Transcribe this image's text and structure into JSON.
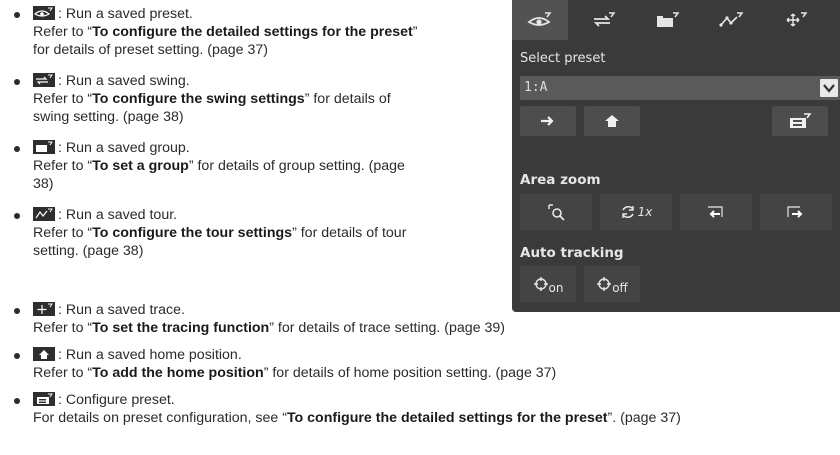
{
  "items": [
    {
      "icon": "preset-eye-icon",
      "lines": [
        [
          {
            "t": ": Run a saved preset.",
            "b": false
          }
        ],
        [
          {
            "t": "Refer to “",
            "b": false
          },
          {
            "t": "To configure the detailed settings for the preset",
            "b": true
          },
          {
            "t": "”",
            "b": false
          }
        ],
        [
          {
            "t": "for details of preset setting. (page 37)",
            "b": false
          }
        ]
      ]
    },
    {
      "icon": "swing-icon",
      "lines": [
        [
          {
            "t": ": Run a saved swing.",
            "b": false
          }
        ],
        [
          {
            "t": "Refer to “",
            "b": false
          },
          {
            "t": "To configure the swing settings",
            "b": true
          },
          {
            "t": "” for details of",
            "b": false
          }
        ],
        [
          {
            "t": "swing setting. (page 38)",
            "b": false
          }
        ]
      ]
    },
    {
      "icon": "group-icon",
      "lines": [
        [
          {
            "t": ": Run a saved group.",
            "b": false
          }
        ],
        [
          {
            "t": "Refer to “",
            "b": false
          },
          {
            "t": "To set a group",
            "b": true
          },
          {
            "t": "” for details of group setting. (page",
            "b": false
          }
        ],
        [
          {
            "t": "38)",
            "b": false
          }
        ]
      ]
    },
    {
      "icon": "tour-icon",
      "lines": [
        [
          {
            "t": ": Run a saved tour.",
            "b": false
          }
        ],
        [
          {
            "t": "Refer to “",
            "b": false
          },
          {
            "t": "To configure the tour settings",
            "b": true
          },
          {
            "t": "” for details of tour",
            "b": false
          }
        ],
        [
          {
            "t": "setting. (page 38)",
            "b": false
          }
        ]
      ]
    },
    {
      "icon": "trace-icon",
      "lines": [
        [
          {
            "t": ": Run a saved trace.",
            "b": false
          }
        ],
        [
          {
            "t": "Refer to “",
            "b": false
          },
          {
            "t": "To set the tracing function",
            "b": true
          },
          {
            "t": "” for details of trace setting. (page 39)",
            "b": false
          }
        ]
      ]
    },
    {
      "icon": "home-icon",
      "lines": [
        [
          {
            "t": ": Run a saved home position.",
            "b": false
          }
        ],
        [
          {
            "t": "Refer to “",
            "b": false
          },
          {
            "t": "To add the home position",
            "b": true
          },
          {
            "t": "” for details of home position setting. (page 37)",
            "b": false
          }
        ]
      ]
    },
    {
      "icon": "configure-preset-icon",
      "lines": [
        [
          {
            "t": ": Configure preset.",
            "b": false
          }
        ],
        [
          {
            "t": "For details on preset configuration, see “",
            "b": false
          },
          {
            "t": "To configure the detailed settings for the preset",
            "b": true
          },
          {
            "t": "”. (page 37)",
            "b": false
          }
        ]
      ]
    }
  ],
  "panel": {
    "tabs": [
      "preset-eye-icon",
      "swing-icon",
      "group-icon",
      "tour-icon",
      "trace-icon"
    ],
    "select_preset_label": "Select preset",
    "preset_value": "1:A",
    "area_zoom_label": "Area zoom",
    "zoom_1x_text": "1x",
    "auto_tracking_label": "Auto tracking",
    "tracking_on_text": "on",
    "tracking_off_text": "off",
    "colors": {
      "panel_bg": "#3a3a3a",
      "button_bg": "#4d4d4d",
      "active_tab": "#525252",
      "text": "#e6e6e6"
    }
  }
}
